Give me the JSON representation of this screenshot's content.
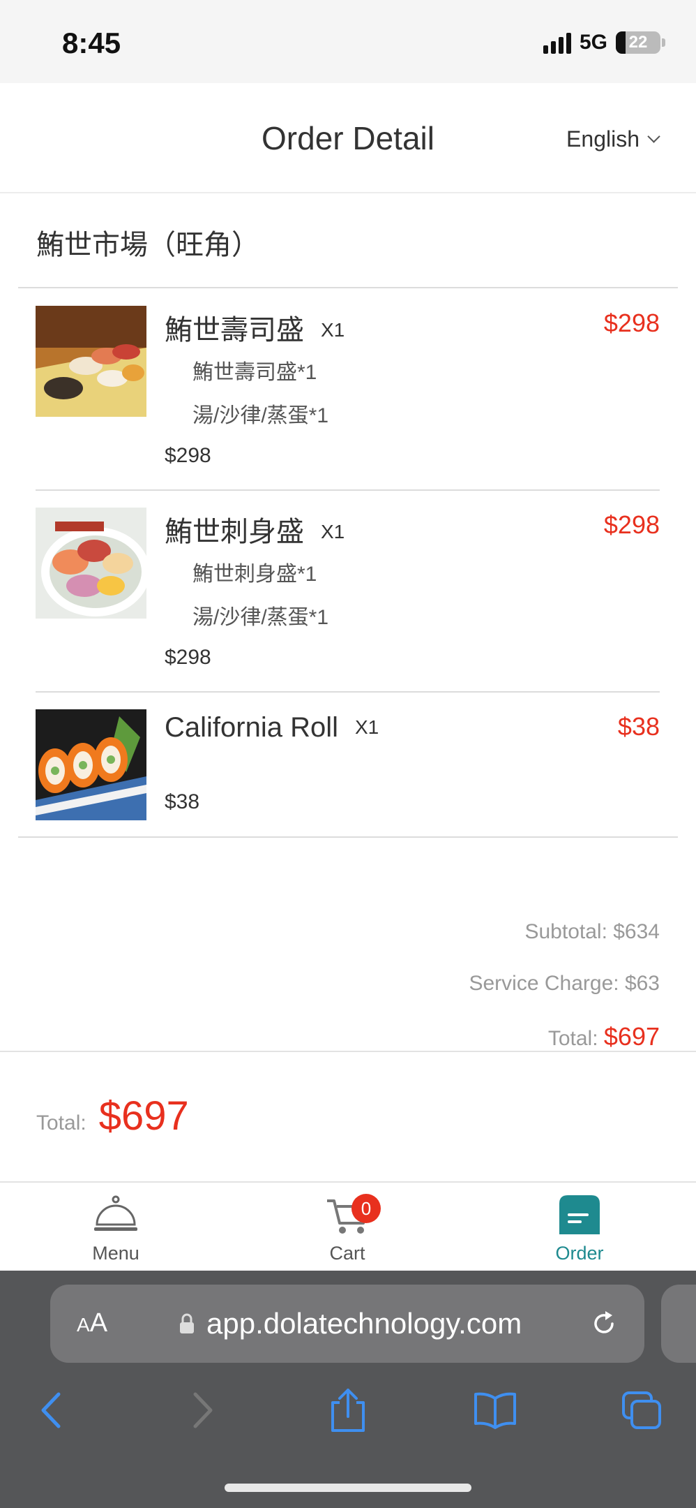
{
  "status_bar": {
    "time": "8:45",
    "network": "5G",
    "battery": "22",
    "battery_level": 0.22
  },
  "header": {
    "title": "Order Detail",
    "language": "English"
  },
  "shop": {
    "name": "鮪世市場（旺角）"
  },
  "items": [
    {
      "name": "鮪世壽司盛",
      "qty": "X1",
      "price": "$298",
      "subitems": [
        "鮪世壽司盛*1",
        "湯/沙律/蒸蛋*1"
      ],
      "base_price": "$298"
    },
    {
      "name": "鮪世刺身盛",
      "qty": "X1",
      "price": "$298",
      "subitems": [
        "鮪世刺身盛*1",
        "湯/沙律/蒸蛋*1"
      ],
      "base_price": "$298"
    },
    {
      "name": "California Roll",
      "qty": "X1",
      "price": "$38",
      "subitems": [],
      "base_price": "$38"
    }
  ],
  "summary": {
    "subtotal_label": "Subtotal:",
    "subtotal": "$634",
    "service_label": "Service Charge:",
    "service": "$63",
    "total_label": "Total:",
    "total": "$697"
  },
  "footer": {
    "total_label": "Total:",
    "total": "$697"
  },
  "tabbar": {
    "menu": "Menu",
    "cart": "Cart",
    "cart_badge": "0",
    "order": "Order"
  },
  "browser": {
    "aa_small": "A",
    "aa_big": "A",
    "url": "app.dolatechnology.com"
  },
  "colors": {
    "accent": "#1e8a8f",
    "price": "#e8301e",
    "browser_bg": "#555658",
    "browser_blue": "#3f8ff0"
  }
}
